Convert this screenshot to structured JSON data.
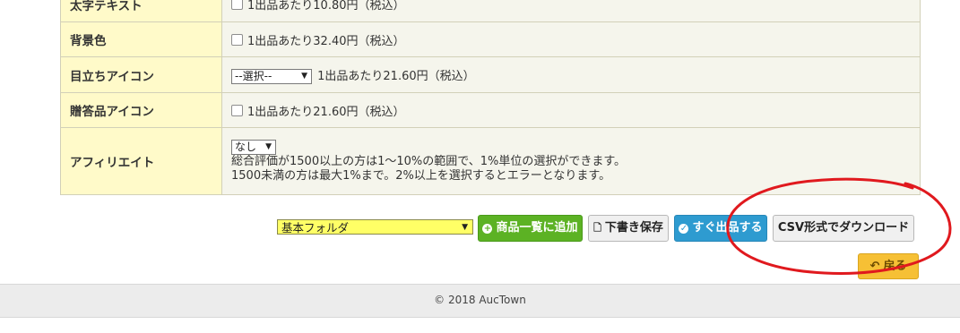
{
  "table": {
    "rows": [
      {
        "label": "太字テキスト",
        "price_text": "1出品あたり10.80円（税込）"
      },
      {
        "label": "背景色",
        "price_text": "1出品あたり32.40円（税込）"
      },
      {
        "label": "目立ちアイコン",
        "select_value": "--選択--",
        "price_text": "1出品あたり21.60円（税込）"
      },
      {
        "label": "贈答品アイコン",
        "price_text": "1出品あたり21.60円（税込）"
      },
      {
        "label": "アフィリエイト",
        "select_value": "なし",
        "note_line1": "総合評価が1500以上の方は1〜10%の範囲で、1%単位の選択ができます。",
        "note_line2": "1500未満の方は最大1%まで。2%以上を選択するとエラーとなります。"
      }
    ]
  },
  "toolbar": {
    "folder_value": "基本フォルダ",
    "add_list_label": "商品一覧に追加",
    "draft_save_label": "下書き保存",
    "list_now_label": "すぐ出品する",
    "csv_download_label": "CSV形式でダウンロード",
    "back_label": "戻る"
  },
  "footer": {
    "copyright": "© 2018 AucTown"
  },
  "colors": {
    "label_bg": "#fffac9",
    "value_bg": "#f5f5ec",
    "green": "#5cb224",
    "blue": "#2e9bd0",
    "back_yellow": "#f6c035",
    "folder_yellow": "#ffff66",
    "annotation_red": "#e0191e"
  },
  "icons": {
    "add": "plus-circle-icon",
    "draft": "document-icon",
    "list_now": "check-circle-icon",
    "back": "return-arrow-icon"
  }
}
